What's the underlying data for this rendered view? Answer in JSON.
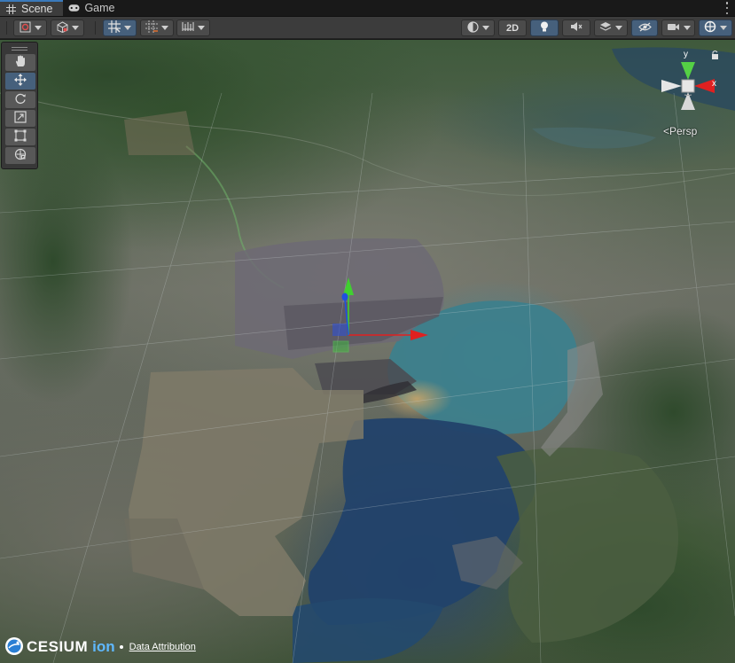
{
  "tabs": [
    {
      "label": "Scene",
      "icon": "grid-icon",
      "active": true
    },
    {
      "label": "Game",
      "icon": "gamepad-icon",
      "active": false
    }
  ],
  "toolbar": {
    "mode_2d_label": "2D"
  },
  "tools": [
    "hand",
    "move",
    "rotate",
    "scale",
    "rect",
    "transform"
  ],
  "gizmo": {
    "y_label": "y",
    "x_label": "x",
    "projection_label": "<Persp"
  },
  "footer": {
    "brand": "CESIUM",
    "ion": "ion",
    "attribution_link": "Data Attribution"
  },
  "colors": {
    "accent": "#3a79bb",
    "toolbar_bg": "#3c3c3c",
    "active_button": "#46607c",
    "axis_x": "#e02020",
    "axis_y": "#40d030",
    "axis_z": "#2050e0"
  }
}
